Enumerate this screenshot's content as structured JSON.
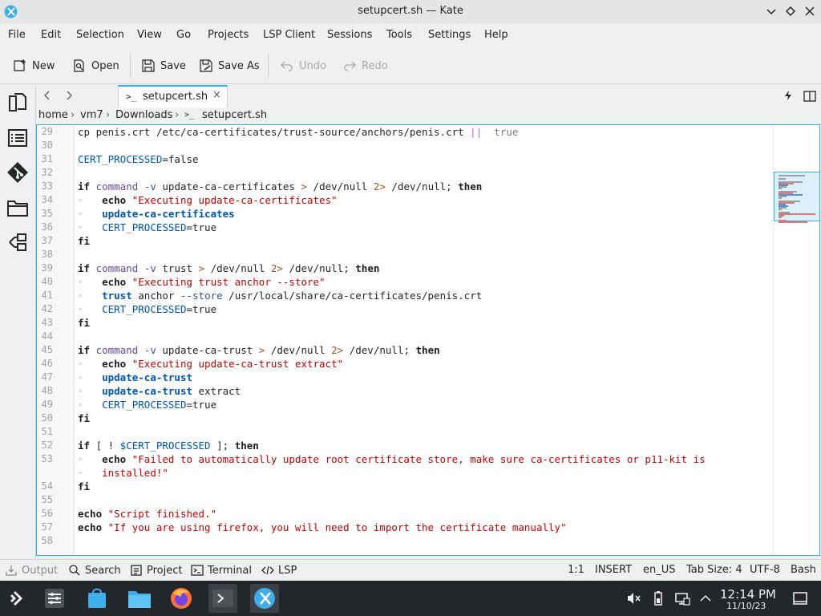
{
  "window": {
    "title": "setupcert.sh — Kate"
  },
  "menu": [
    "File",
    "Edit",
    "Selection",
    "View",
    "Go",
    "Projects",
    "LSP Client",
    "Sessions",
    "Tools",
    "Settings",
    "Help"
  ],
  "toolbar": {
    "new_label": "New",
    "open_label": "Open",
    "save_label": "Save",
    "save_as_label": "Save As",
    "undo_label": "Undo",
    "redo_label": "Redo"
  },
  "tabs": [
    {
      "label": "setupcert.sh",
      "icon": "terminal-icon",
      "close": "×"
    }
  ],
  "breadcrumb": [
    "home",
    "vm7",
    "Downloads",
    "setupcert.sh"
  ],
  "editor": {
    "line_numbers": [
      "29",
      "30",
      "31",
      "32",
      "33",
      "34",
      "35",
      "36",
      "37",
      "38",
      "39",
      "40",
      "41",
      "42",
      "43",
      "44",
      "45",
      "46",
      "47",
      "48",
      "49",
      "50",
      "51",
      "52",
      "53",
      "",
      "54",
      "55",
      "56",
      "57",
      "58"
    ],
    "lines": [
      [
        [
          "",
          "cp penis.crt /etc/ca-certificates/trust-source/anchors/penis.crt "
        ],
        [
          "op",
          "||"
        ],
        [
          "",
          "  "
        ],
        [
          "lit",
          "true"
        ]
      ],
      [],
      [
        [
          "var",
          "CERT_PROCESSED"
        ],
        [
          "",
          "=false"
        ]
      ],
      [],
      [
        [
          "kw",
          "if"
        ],
        [
          "",
          " "
        ],
        [
          "cmd",
          "command"
        ],
        [
          "",
          " "
        ],
        [
          "flag",
          "-v"
        ],
        [
          "",
          " update-ca-certificates "
        ],
        [
          "red",
          ">"
        ],
        [
          "",
          " /dev/null "
        ],
        [
          "red",
          "2>"
        ],
        [
          "",
          " /dev/null; "
        ],
        [
          "kw",
          "then"
        ]
      ],
      [
        [
          "",
          "    "
        ],
        [
          "kw",
          "echo"
        ],
        [
          "",
          " "
        ],
        [
          "str",
          "\"Executing update-ca-certificates\""
        ]
      ],
      [
        [
          "",
          "    "
        ],
        [
          "bi",
          "update-ca-certificates"
        ]
      ],
      [
        [
          "",
          "    "
        ],
        [
          "var",
          "CERT_PROCESSED"
        ],
        [
          "",
          "=true"
        ]
      ],
      [
        [
          "kw",
          "fi"
        ]
      ],
      [],
      [
        [
          "kw",
          "if"
        ],
        [
          "",
          " "
        ],
        [
          "cmd",
          "command"
        ],
        [
          "",
          " "
        ],
        [
          "flag",
          "-v"
        ],
        [
          "",
          " trust "
        ],
        [
          "red",
          ">"
        ],
        [
          "",
          " /dev/null "
        ],
        [
          "red",
          "2>"
        ],
        [
          "",
          " /dev/null; "
        ],
        [
          "kw",
          "then"
        ]
      ],
      [
        [
          "",
          "    "
        ],
        [
          "kw",
          "echo"
        ],
        [
          "",
          " "
        ],
        [
          "str",
          "\"Executing trust anchor --store\""
        ]
      ],
      [
        [
          "",
          "    "
        ],
        [
          "bi",
          "trust"
        ],
        [
          "",
          " anchor "
        ],
        [
          "flag",
          "--store"
        ],
        [
          "",
          " /usr/local/share/ca-certificates/penis.crt"
        ]
      ],
      [
        [
          "",
          "    "
        ],
        [
          "var",
          "CERT_PROCESSED"
        ],
        [
          "",
          "=true"
        ]
      ],
      [
        [
          "kw",
          "fi"
        ]
      ],
      [],
      [
        [
          "kw",
          "if"
        ],
        [
          "",
          " "
        ],
        [
          "cmd",
          "command"
        ],
        [
          "",
          " "
        ],
        [
          "flag",
          "-v"
        ],
        [
          "",
          " update-ca-trust "
        ],
        [
          "red",
          ">"
        ],
        [
          "",
          " /dev/null "
        ],
        [
          "red",
          "2>"
        ],
        [
          "",
          " /dev/null; "
        ],
        [
          "kw",
          "then"
        ]
      ],
      [
        [
          "",
          "    "
        ],
        [
          "kw",
          "echo"
        ],
        [
          "",
          " "
        ],
        [
          "str",
          "\"Executing update-ca-trust extract\""
        ]
      ],
      [
        [
          "",
          "    "
        ],
        [
          "bi",
          "update-ca-trust"
        ]
      ],
      [
        [
          "",
          "    "
        ],
        [
          "bi",
          "update-ca-trust"
        ],
        [
          "",
          " extract"
        ]
      ],
      [
        [
          "",
          "    "
        ],
        [
          "var",
          "CERT_PROCESSED"
        ],
        [
          "",
          "=true"
        ]
      ],
      [
        [
          "kw",
          "fi"
        ]
      ],
      [],
      [
        [
          "kw",
          "if"
        ],
        [
          "",
          " [ ! "
        ],
        [
          "var",
          "$CERT_PROCESSED"
        ],
        [
          "",
          " ]; "
        ],
        [
          "kw",
          "then"
        ]
      ],
      [
        [
          "",
          "    "
        ],
        [
          "kw",
          "echo"
        ],
        [
          "",
          " "
        ],
        [
          "str",
          "\"Failed to automatically update root certificate store, make sure ca-certificates or p11-kit is"
        ]
      ],
      [
        [
          "",
          "    "
        ],
        [
          "str",
          "installed!\""
        ]
      ],
      [
        [
          "kw",
          "fi"
        ]
      ],
      [],
      [
        [
          "kw",
          "echo"
        ],
        [
          "",
          " "
        ],
        [
          "str",
          "\"Script finished.\""
        ]
      ],
      [
        [
          "kw",
          "echo"
        ],
        [
          "",
          " "
        ],
        [
          "str",
          "\"If you are using firefox, you will need to import the certificate manually\""
        ]
      ],
      []
    ]
  },
  "statusbar": {
    "output": "Output",
    "search": "Search",
    "project": "Project",
    "terminal": "Terminal",
    "lsp": "LSP",
    "cursor": "1:1",
    "mode": "INSERT",
    "language": "en_US",
    "tab_size": "Tab Size: 4",
    "encoding": "UTF-8",
    "syntax": "Bash"
  },
  "taskbar": {
    "time": "12:14 PM",
    "date": "11/10/23"
  },
  "colors": {
    "accent": "#3daee9",
    "taskbar": "#23262b"
  }
}
